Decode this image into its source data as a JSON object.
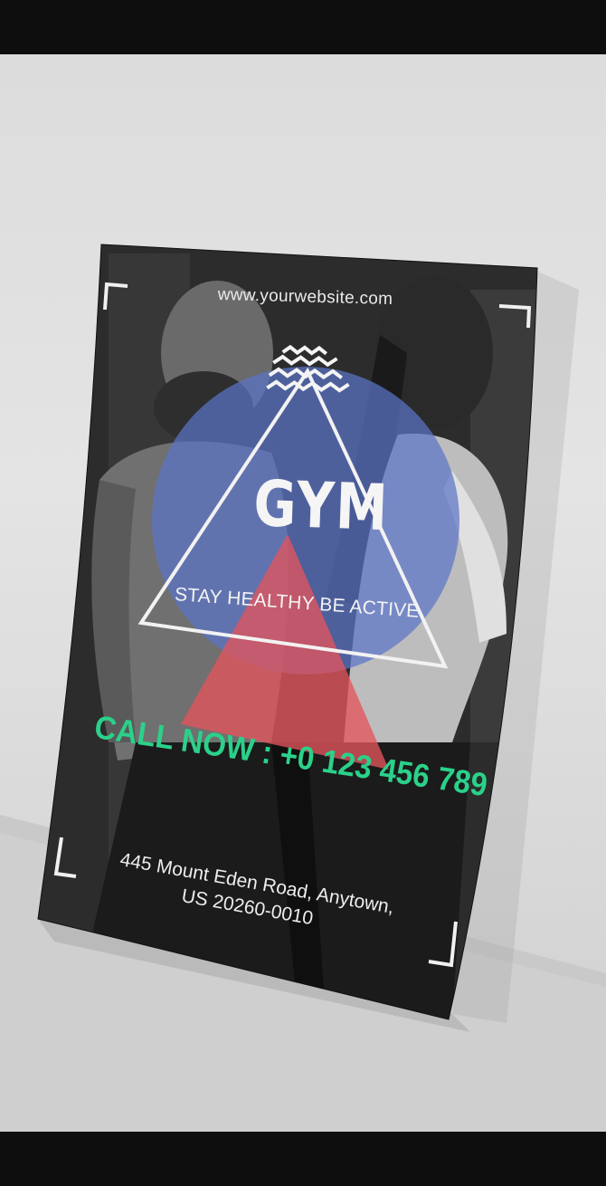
{
  "poster": {
    "website": "www.yourwebsite.com",
    "title": "GYM",
    "slogan": "STAY HEALTHY BE ACTIVE",
    "call_now": "CALL NOW : +0 123 456 789",
    "address_line1": "445 Mount Eden Road, Anytown,",
    "address_line2": "US 20260-0010"
  },
  "colors": {
    "accent_green": "#2bd18a",
    "circle_blue": "#5b74c8",
    "triangle_red": "#e2545c",
    "poster_dark": "#1f1f1f",
    "wall": "#e0e0e0"
  },
  "icons": {
    "logo": "wave-lines-icon"
  }
}
